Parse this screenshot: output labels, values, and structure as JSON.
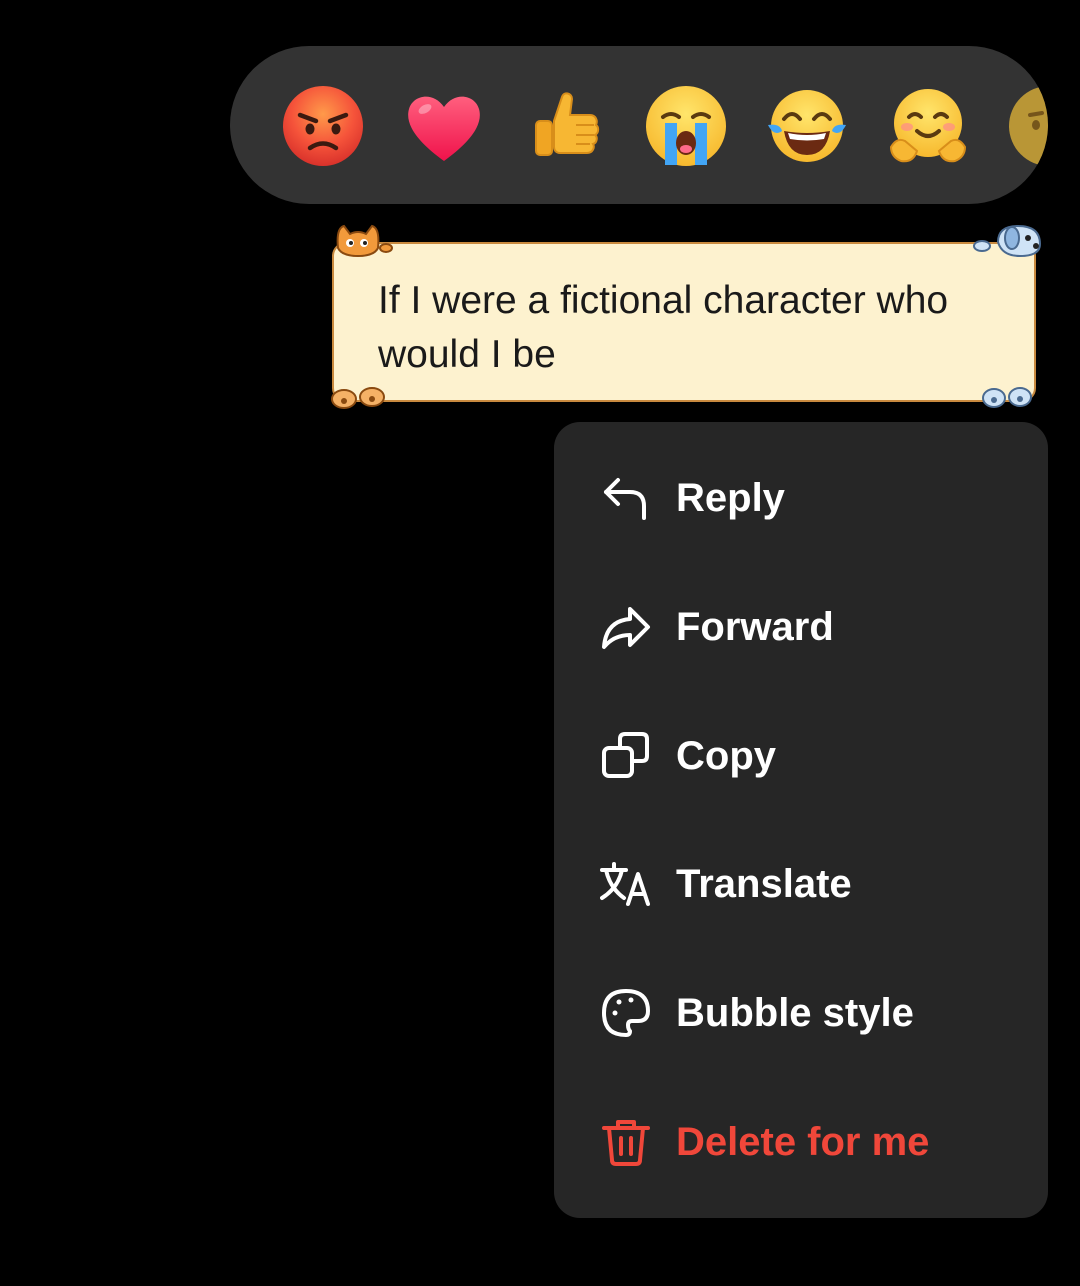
{
  "reactions": [
    {
      "name": "angry-face",
      "glyph": "😡"
    },
    {
      "name": "heart",
      "glyph": "❤️"
    },
    {
      "name": "thumbs-up",
      "glyph": "👍"
    },
    {
      "name": "crying-face",
      "glyph": "😭"
    },
    {
      "name": "tears-of-joy",
      "glyph": "😂"
    },
    {
      "name": "hugging-face",
      "glyph": "🤗"
    },
    {
      "name": "thinking-face",
      "glyph": "🤔"
    }
  ],
  "message": {
    "text": "If I were a fictional character who\nwould I be",
    "bubble_style": "cat-and-dog-paper"
  },
  "menu": {
    "items": [
      {
        "label": "Reply",
        "icon": "reply-icon"
      },
      {
        "label": "Forward",
        "icon": "forward-icon"
      },
      {
        "label": "Copy",
        "icon": "copy-icon"
      },
      {
        "label": "Translate",
        "icon": "translate-icon"
      },
      {
        "label": "Bubble style",
        "icon": "palette-icon"
      },
      {
        "label": "Delete for me",
        "icon": "trash-icon"
      }
    ]
  },
  "colors": {
    "background": "#000000",
    "reaction_bar": "#333333",
    "menu_background": "#262626",
    "menu_text": "#ffffff",
    "danger": "#f0473a",
    "bubble_fill": "#fdf2cf",
    "bubble_border": "#c98a3f"
  }
}
